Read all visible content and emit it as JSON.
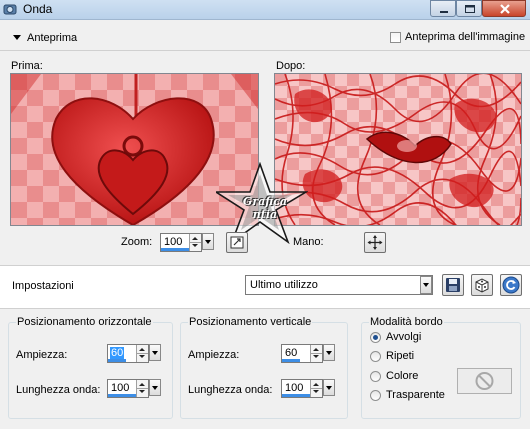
{
  "window": {
    "title": "Onda",
    "minimize_icon": "minimize-icon",
    "maximize_icon": "maximize-icon",
    "close_icon": "close-icon"
  },
  "preview": {
    "section_label": "Anteprima",
    "image_preview_label": "Anteprima dell'immagine",
    "image_preview_checked": false,
    "before_label": "Prima:",
    "after_label": "Dopo:",
    "watermark": "Grafica ntia",
    "zoom_label": "Zoom:",
    "zoom_value": "100",
    "hand_label": "Mano:",
    "pan_icon": "move-icon",
    "fit_icon": "fit-window-icon"
  },
  "settings": {
    "label": "Impostazioni",
    "preset_value": "Ultimo utilizzo",
    "save_icon": "save-icon",
    "random_icon": "dice-icon",
    "reset_icon": "reset-icon"
  },
  "horizontal": {
    "title": "Posizionamento orizzontale",
    "amplitude_label": "Ampiezza:",
    "amplitude_value": "60",
    "wavelength_label": "Lunghezza onda:",
    "wavelength_value": "100"
  },
  "vertical": {
    "title": "Posizionamento verticale",
    "amplitude_label": "Ampiezza:",
    "amplitude_value": "60",
    "wavelength_label": "Lunghezza onda:",
    "wavelength_value": "100"
  },
  "edge_mode": {
    "title": "Modalità bordo",
    "options": [
      "Avvolgi",
      "Ripeti",
      "Colore",
      "Trasparente"
    ],
    "selected": "Avvolgi",
    "color_swatch_icon": "no-color-icon"
  },
  "colors": {
    "accent": "#3399ff",
    "heart_red": "#d42020",
    "titlebar": "#b9d1ea"
  }
}
